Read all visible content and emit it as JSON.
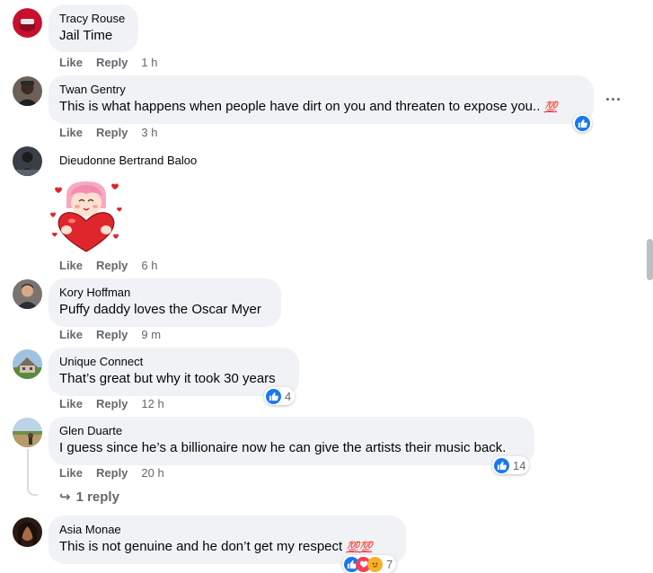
{
  "actions": {
    "like": "Like",
    "reply": "Reply"
  },
  "comments": [
    {
      "author": "Tracy Rouse",
      "text": "Jail Time",
      "time": "1 h"
    },
    {
      "author": "Twan Gentry",
      "text": "This is what happens when people have dirt on you and threaten to expose you..",
      "emoji": "💯",
      "time": "3 h"
    },
    {
      "author": "Dieudonne Bertrand Baloo",
      "sticker": "heart-girl-sticker",
      "time": "6 h"
    },
    {
      "author": "Kory Hoffman",
      "text": "Puffy daddy loves the Oscar Myer",
      "time": "9 m"
    },
    {
      "author": "Unique Connect",
      "text": "That’s great but why it took 30 years",
      "time": "12 h",
      "reactions": "4"
    },
    {
      "author": "Glen Duarte",
      "text": "I guess since he’s a billionaire now he can give the artists their music back.",
      "time": "20 h",
      "reactions": "14",
      "replies": "1 reply"
    },
    {
      "author": "Asia Monae",
      "text": "This is not genuine and he don’t get my respect",
      "emoji": "💯💯",
      "reactions": "7"
    }
  ],
  "colors": {
    "like_blue": "#1877f2",
    "bubble_bg": "#f0f2f5",
    "muted_text": "#65676b"
  }
}
